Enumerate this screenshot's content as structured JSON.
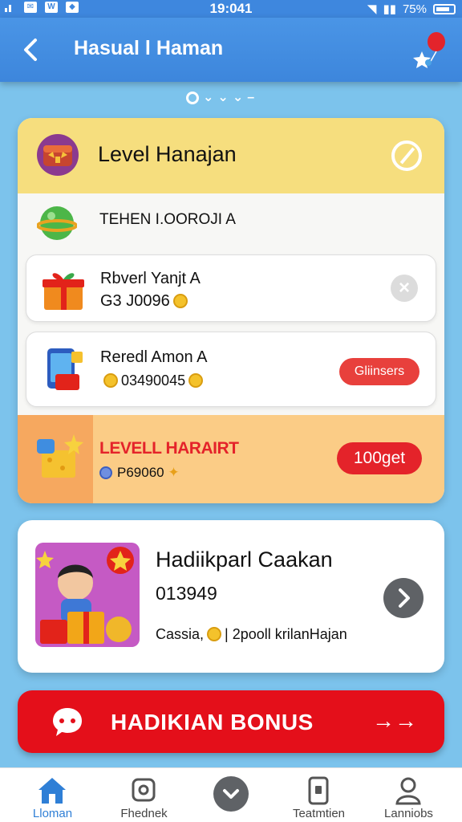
{
  "status_bar": {
    "time": "19:041",
    "battery": "75%"
  },
  "app_bar": {
    "title": "Hasual l Haman"
  },
  "card": {
    "header_title": "Level Hanajan",
    "row0_text": "TEHEN I.OOROJI A",
    "rows": [
      {
        "name": "Rbverl Yanjt A",
        "sub": "G3 J0096"
      },
      {
        "name": "Reredl Amon A",
        "sub": "03490045",
        "button": "Gliinsers"
      }
    ],
    "highlight": {
      "name": "LEVELL HARAIRT",
      "sub": "P69060",
      "button": "100get"
    }
  },
  "promo": {
    "title": "Hadiikparl Caakan",
    "number": "013949",
    "desc_prefix": "Cassia,",
    "desc_suffix": "| 2pooll krilanHajan"
  },
  "bonus": {
    "label": "HADIKIAN BONUS",
    "arrow": "→→"
  },
  "nav": {
    "items": [
      "Lloman",
      "Fhednek",
      "",
      "Teatmtien",
      "Lanniobs"
    ]
  },
  "colors": {
    "primary": "#3e87de",
    "accent_red": "#e40f1a",
    "card_yellow": "#f6de7e",
    "card_orange": "#fbcc86"
  }
}
